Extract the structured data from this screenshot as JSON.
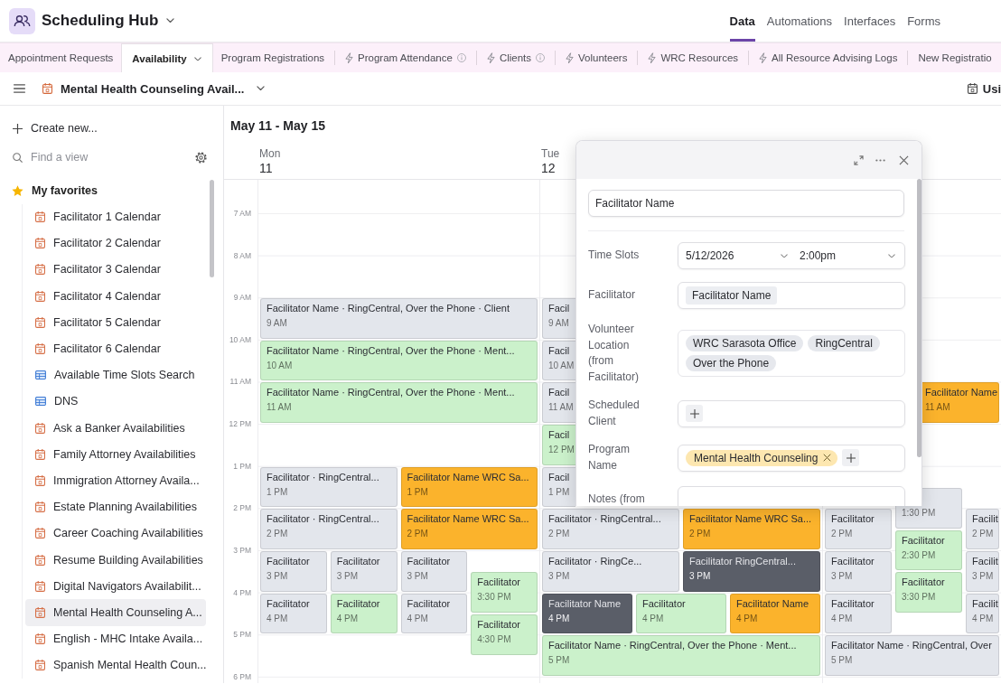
{
  "app": {
    "name": "Scheduling Hub"
  },
  "nav": [
    {
      "label": "Data",
      "selected": true
    },
    {
      "label": "Automations",
      "selected": false
    },
    {
      "label": "Interfaces",
      "selected": false
    },
    {
      "label": "Forms",
      "selected": false
    }
  ],
  "tabs": [
    {
      "label": "Appointment Requests",
      "kind": "table",
      "selected": false,
      "info": false
    },
    {
      "label": "Availability",
      "kind": "table",
      "selected": true,
      "info": false
    },
    {
      "label": "Program Registrations",
      "kind": "table",
      "selected": false,
      "info": false
    },
    {
      "label": "Program Attendance",
      "kind": "synced",
      "selected": false,
      "info": true
    },
    {
      "label": "Clients",
      "kind": "synced",
      "selected": false,
      "info": true
    },
    {
      "label": "Volunteers",
      "kind": "synced",
      "selected": false,
      "info": false
    },
    {
      "label": "WRC Resources",
      "kind": "synced",
      "selected": false,
      "info": false
    },
    {
      "label": "All Resource Advising Logs",
      "kind": "synced",
      "selected": false,
      "info": false
    },
    {
      "label": "New Registratio",
      "kind": "table",
      "selected": false,
      "info": false
    }
  ],
  "view_bar": {
    "view_name": "Mental Health Counseling Avail...",
    "action": "Usi"
  },
  "sidebar": {
    "create": "Create new...",
    "search": {
      "placeholder": "Find a view"
    },
    "favorites": {
      "title": "My favorites",
      "items": [
        {
          "label": "Facilitator 1 Calendar",
          "kind": "calendar",
          "selected": false
        },
        {
          "label": "Facilitator 2 Calendar",
          "kind": "calendar",
          "selected": false
        },
        {
          "label": "Facilitator 3 Calendar",
          "kind": "calendar",
          "selected": false
        },
        {
          "label": "Facilitator 4 Calendar",
          "kind": "calendar",
          "selected": false
        },
        {
          "label": "Facilitator 5 Calendar",
          "kind": "calendar",
          "selected": false
        },
        {
          "label": "Facilitator 6 Calendar",
          "kind": "calendar",
          "selected": false
        },
        {
          "label": "Available Time Slots Search",
          "kind": "grid",
          "selected": false
        },
        {
          "label": "DNS",
          "kind": "grid",
          "selected": false
        },
        {
          "label": "Ask a Banker Availabilities",
          "kind": "calendar",
          "selected": false
        },
        {
          "label": "Family Attorney Availabilities",
          "kind": "calendar",
          "selected": false
        },
        {
          "label": "Immigration Attorney Availa...",
          "kind": "calendar",
          "selected": false
        },
        {
          "label": "Estate Planning Availabilities",
          "kind": "calendar",
          "selected": false
        },
        {
          "label": "Career Coaching Availabilities",
          "kind": "calendar",
          "selected": false
        },
        {
          "label": "Resume Building Availabilities",
          "kind": "calendar",
          "selected": false
        },
        {
          "label": "Digital Navigators Availabilit...",
          "kind": "calendar",
          "selected": false
        },
        {
          "label": "Mental Health Counseling A...",
          "kind": "calendar",
          "selected": true
        },
        {
          "label": "English - MHC Intake Availa...",
          "kind": "calendar",
          "selected": false
        },
        {
          "label": "Spanish Mental Health Coun...",
          "kind": "calendar",
          "selected": false
        }
      ]
    }
  },
  "calendar": {
    "range": "May 11 - May 15",
    "hours": [
      "7 AM",
      "8 AM",
      "9 AM",
      "10 AM",
      "11 AM",
      "12 PM",
      "1 PM",
      "2 PM",
      "3 PM",
      "4 PM",
      "5 PM",
      "6 PM"
    ],
    "days": [
      {
        "name": "Mon",
        "date": "11",
        "events": [
          {
            "title": "Facilitator Name · RingCentral, Over the Phone · Client",
            "time": "9 AM",
            "color": "#e3e6ec"
          },
          {
            "title": "Facilitator Name · RingCentral, Over the Phone · Ment...",
            "time": "10 AM",
            "color": "#cbf1cb"
          },
          {
            "title": "Facilitator Name · RingCentral, Over the Phone · Ment...",
            "time": "11 AM",
            "color": "#cbf1cb"
          },
          {
            "title": "Facilitator · RingCentral...",
            "time": "1 PM",
            "color": "#e3e6ec"
          },
          {
            "title": "Facilitator Name WRC Sa...",
            "time": "1 PM",
            "color": "#fbb32c"
          },
          {
            "title": "Facilitator · RingCentral...",
            "time": "2 PM",
            "color": "#e3e6ec"
          },
          {
            "title": "Facilitator Name WRC Sa...",
            "time": "2 PM",
            "color": "#fbb32c"
          },
          {
            "title": "Facilitator",
            "time": "3 PM",
            "color": "#e3e6ec"
          },
          {
            "title": "Facilitator",
            "time": "3 PM",
            "color": "#e3e6ec"
          },
          {
            "title": "Facilitator",
            "time": "3 PM",
            "color": "#e3e6ec"
          },
          {
            "title": "Facilitator",
            "time": "3:30 PM",
            "color": "#cbf1cb"
          },
          {
            "title": "Facilitator",
            "time": "4 PM",
            "color": "#e3e6ec"
          },
          {
            "title": "Facilitator",
            "time": "4 PM",
            "color": "#cbf1cb"
          },
          {
            "title": "Facilitator",
            "time": "4 PM",
            "color": "#e3e6ec"
          },
          {
            "title": "Facilitator",
            "time": "4:30 PM",
            "color": "#cbf1cb"
          }
        ]
      },
      {
        "name": "Tue",
        "date": "12",
        "events": [
          {
            "title": "Facil",
            "time": "9 AM",
            "color": "#e3e6ec"
          },
          {
            "title": "Facil",
            "time": "10 AM",
            "color": "#e3e6ec"
          },
          {
            "title": "Facil",
            "time": "11 AM",
            "color": "#e3e6ec"
          },
          {
            "title": "Facil",
            "time": "12 PM",
            "color": "#cbf1cb"
          },
          {
            "title": "Facil",
            "time": "1 PM",
            "color": "#e3e6ec"
          },
          {
            "title": "Facilitator · RingCentral...",
            "time": "2 PM",
            "color": "#e3e6ec"
          },
          {
            "title": "Facilitator Name WRC Sa...",
            "time": "2 PM",
            "color": "#fbb32c"
          },
          {
            "title": "Facilitator · RingCe...",
            "time": "3 PM",
            "color": "#e3e6ec"
          },
          {
            "title": "Facilitator RingCentral...",
            "time": "3 PM",
            "color": "#5a5e68"
          },
          {
            "title": "Facilitator Name",
            "time": "4 PM",
            "color": "#5a5e68"
          },
          {
            "title": "Facilitator",
            "time": "4 PM",
            "color": "#cbf1cb"
          },
          {
            "title": "Facilitator Name",
            "time": "4 PM",
            "color": "#fbb32c"
          },
          {
            "title": "Facilitator Name · RingCentral, Over the Phone · Ment...",
            "time": "5 PM",
            "color": "#cbf1cb"
          }
        ]
      },
      {
        "events": [
          {
            "title": "Facilitator Name",
            "time": "11 AM",
            "color": "#fbb32c"
          },
          {
            "time": "1:30 PM",
            "color": "#e3e6ec"
          },
          {
            "title": "Facilitator",
            "time": "2 PM",
            "color": "#e3e6ec"
          },
          {
            "title": "Facilit",
            "time": "2 PM",
            "color": "#e3e6ec"
          },
          {
            "title": "Facilitator",
            "time": "2:30 PM",
            "color": "#cbf1cb"
          },
          {
            "title": "Facilitator",
            "time": "3 PM",
            "color": "#e3e6ec"
          },
          {
            "title": "Facilit",
            "time": "3 PM",
            "color": "#e3e6ec"
          },
          {
            "title": "Facilitator",
            "time": "3:30 PM",
            "color": "#cbf1cb"
          },
          {
            "title": "Facilitator",
            "time": "4 PM",
            "color": "#e3e6ec"
          },
          {
            "title": "Facilit",
            "time": "4 PM",
            "color": "#e3e6ec"
          },
          {
            "title": "Facilitator Name · RingCentral, Over",
            "time": "5 PM",
            "color": "#e3e6ec"
          }
        ]
      }
    ]
  },
  "record": {
    "title": "Facilitator Name",
    "fields": [
      {
        "label": "Time Slots",
        "kind": "datetime",
        "date": "5/12/2026",
        "time": "2:00pm"
      },
      {
        "label": "Facilitator",
        "kind": "link",
        "values": [
          "Facilitator Name"
        ]
      },
      {
        "label": "Volunteer Location (from Facilitator)",
        "kind": "lookup",
        "values": [
          "WRC Sarasota Office",
          "RingCentral",
          "Over the Phone"
        ]
      },
      {
        "label": "Scheduled Client",
        "kind": "link"
      },
      {
        "label": "Program Name",
        "kind": "multiselect",
        "values": [
          {
            "label": "Mental Health Counseling",
            "color": "#fde7b0"
          }
        ]
      },
      {
        "label": "Notes (from",
        "kind": "text"
      }
    ]
  }
}
